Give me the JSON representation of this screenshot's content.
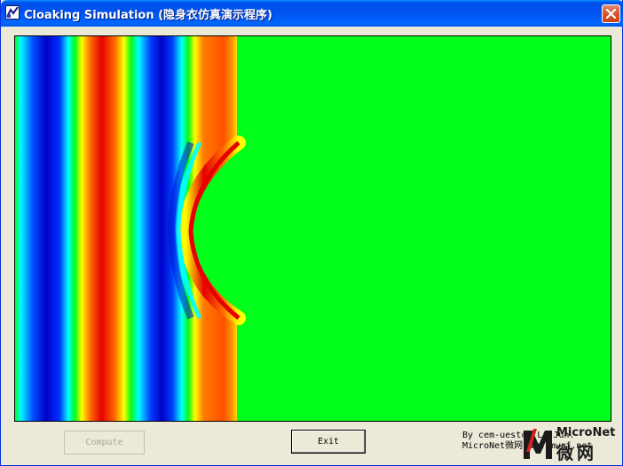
{
  "window": {
    "title": "Cloaking Simulation (隐身衣仿真演示程序)",
    "app_icon": "matlab-figure-icon",
    "close_icon": "close-icon",
    "colors": {
      "titlebar": "#0053ee",
      "window_bg": "#ece9d8",
      "close_button": "#d8542a"
    }
  },
  "simulation": {
    "colormap": "jet",
    "colors": {
      "dark_blue": "#0000c8",
      "blue": "#0030ff",
      "cyan": "#00ffff",
      "green": "#00ff1a",
      "yellow": "#ffff00",
      "orange": "#ff6a00",
      "red": "#e60000"
    }
  },
  "buttons": {
    "compute_label": "Compute",
    "exit_label": "Exit"
  },
  "credit": {
    "line1": "By cem-uestc, Li Jun.",
    "line2": "MicroNet微网 www.mwrf.net"
  },
  "watermark": {
    "brand": "MicroNet",
    "brand_cn": "微网",
    "logo_icon": "micronet-logo-icon"
  }
}
